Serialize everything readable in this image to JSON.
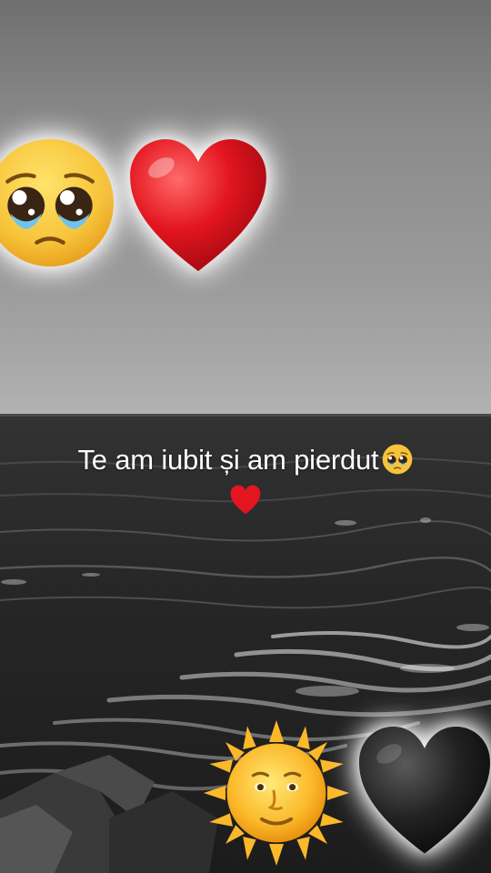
{
  "caption": {
    "line1": "Te am iubit și am pierdut"
  },
  "emojis": {
    "top_left": "pleading-face-icon",
    "top_right": "red-heart-icon",
    "caption_face": "pleading-face-icon",
    "caption_heart": "red-heart-icon",
    "bottom_left": "sun-with-face-icon",
    "bottom_right": "black-heart-icon"
  },
  "colors": {
    "heart_red": "#e3151f",
    "face_yellow": "#f7c43a",
    "sun_yellow": "#fbb829",
    "black_heart": "#222222",
    "text": "#ffffff"
  }
}
